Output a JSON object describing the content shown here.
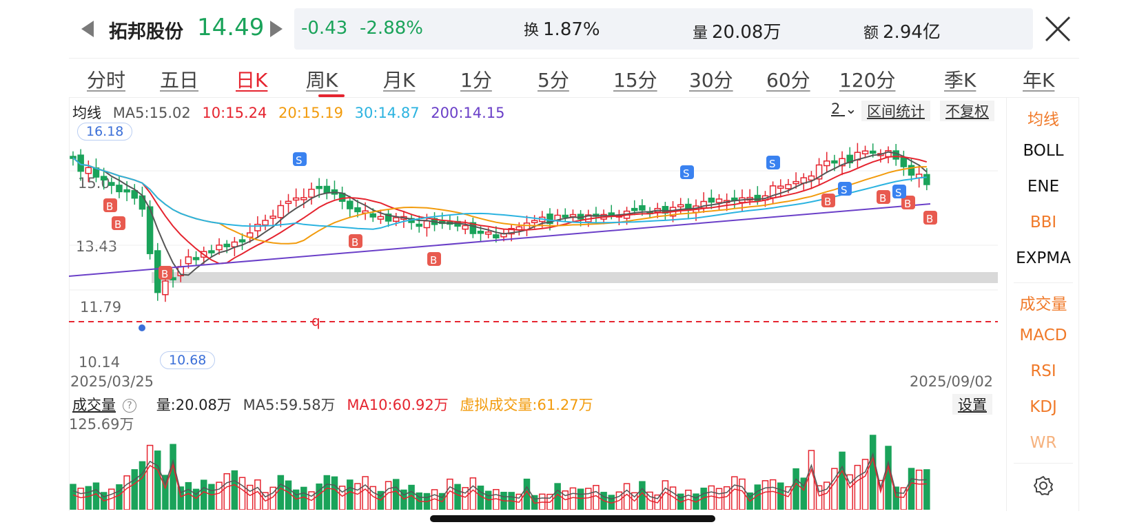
{
  "header": {
    "stock_name": "拓邦股份",
    "price": "14.49",
    "change": "-0.43",
    "change_pct": "-2.88%",
    "turnover_label": "换",
    "turnover": "1.87%",
    "volume_label": "量",
    "volume": "20.08万",
    "amount_label": "额",
    "amount": "2.94亿"
  },
  "tabs": [
    "分时",
    "五日",
    "日K",
    "周K",
    "月K",
    "1分",
    "5分",
    "15分",
    "30分",
    "60分",
    "120分",
    "季K",
    "年K"
  ],
  "active_tab": "日K",
  "ma_row": {
    "label": "均线",
    "ma5": "MA5:15.02",
    "ma10": "10:15.24",
    "ma20": "20:15.19",
    "ma30": "30:14.87",
    "ma200": "200:14.15"
  },
  "toolbar": {
    "count": "2",
    "range_stats": "区间统计",
    "adjust": "不复权"
  },
  "price_axis": {
    "labels": [
      "15.0",
      "13.43",
      "11.79",
      "10.14"
    ],
    "high_bubble": "16.18",
    "low_bubble": "10.68",
    "start_date": "2025/03/25",
    "end_date": "2025/09/02",
    "dashed_label": "q"
  },
  "volume_panel": {
    "title": "成交量",
    "help": "?",
    "volume": "量:20.08万",
    "ma5": "MA5:59.58万",
    "ma10": "MA10:60.92万",
    "virtual": "虚拟成交量:61.27万",
    "settings": "设置",
    "max_label": "125.69万"
  },
  "side_panel": {
    "items": [
      "均线",
      "BOLL",
      "ENE",
      "BBI",
      "EXPMA",
      "成交量",
      "MACD",
      "RSI",
      "KDJ",
      "WR"
    ]
  },
  "markers": {
    "buy": "B",
    "sell": "S"
  },
  "colors": {
    "up": "#e5242f",
    "down": "#1aa35a",
    "ma5": "#555555",
    "ma10": "#e5242f",
    "ma20": "#f29b0c",
    "ma30": "#2bb3e0",
    "ma200": "#6a3fc8",
    "buy_marker": "#e85a4f",
    "sell_marker": "#3a82f0"
  }
}
